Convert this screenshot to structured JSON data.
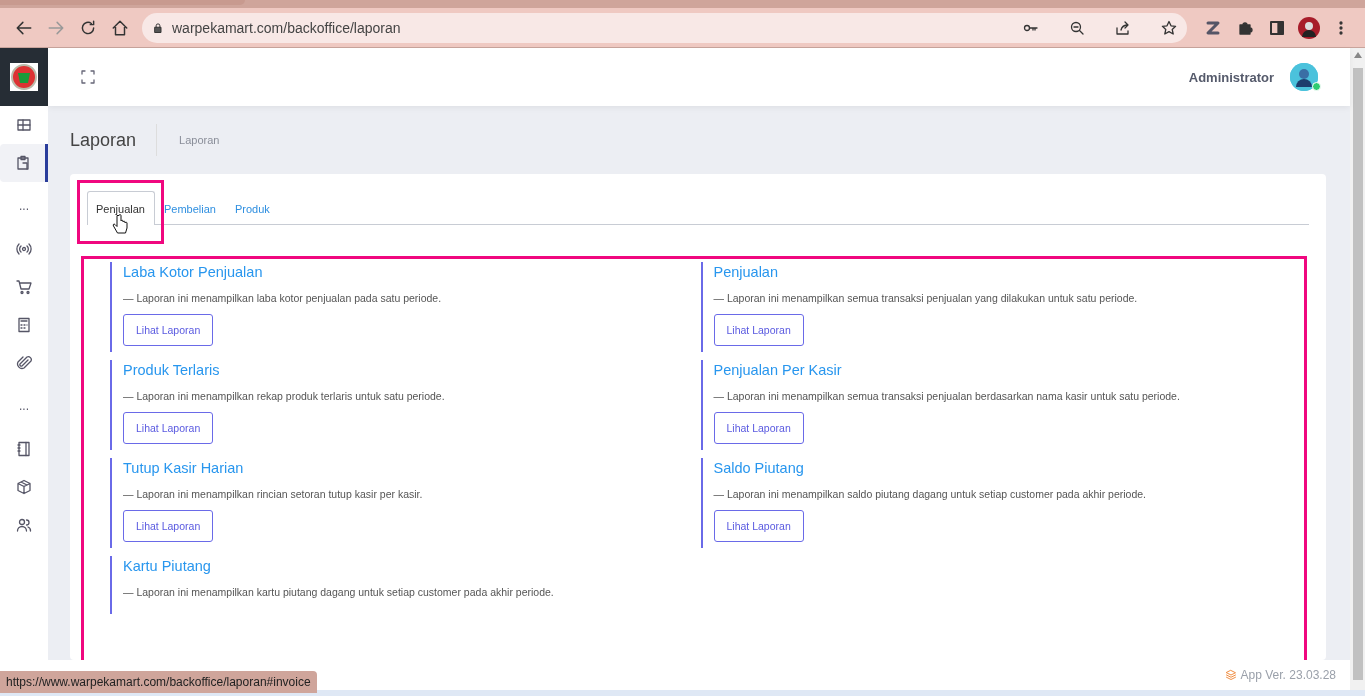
{
  "browser": {
    "url": "warpekamart.com/backoffice/laporan",
    "status_url": "https://www.warpekamart.com/backoffice/laporan#invoice"
  },
  "sidebar": {
    "items": [
      {
        "kind": "icon",
        "selected": false
      },
      {
        "kind": "icon",
        "selected": true
      },
      {
        "kind": "dots",
        "text": "...",
        "selected": false
      },
      {
        "kind": "icon",
        "selected": false
      },
      {
        "kind": "icon",
        "selected": false
      },
      {
        "kind": "icon",
        "selected": false
      },
      {
        "kind": "icon",
        "selected": false
      },
      {
        "kind": "dots",
        "text": "...",
        "selected": false
      },
      {
        "kind": "icon",
        "selected": false
      },
      {
        "kind": "icon",
        "selected": false
      },
      {
        "kind": "icon",
        "selected": false
      }
    ]
  },
  "header": {
    "user": "Administrator",
    "online": true
  },
  "page": {
    "title": "Laporan",
    "breadcrumb": "Laporan"
  },
  "tabs": [
    {
      "label": "Penjualan",
      "selected": true
    },
    {
      "label": "Pembelian",
      "selected": false
    },
    {
      "label": "Produk",
      "selected": false
    }
  ],
  "reports": [
    {
      "title": "Laba Kotor Penjualan",
      "description": "— Laporan ini menampilkan laba kotor penjualan pada satu periode.",
      "button": "Lihat Laporan"
    },
    {
      "title": "Penjualan",
      "description": "— Laporan ini menampilkan semua transaksi penjualan yang dilakukan untuk satu periode.",
      "button": "Lihat Laporan"
    },
    {
      "title": "Produk Terlaris",
      "description": "— Laporan ini menampilkan rekap produk terlaris untuk satu periode.",
      "button": "Lihat Laporan"
    },
    {
      "title": "Penjualan Per Kasir",
      "description": "— Laporan ini menampilkan semua transaksi penjualan berdasarkan nama kasir untuk satu periode.",
      "button": "Lihat Laporan"
    },
    {
      "title": "Tutup Kasir Harian",
      "description": "— Laporan ini menampilkan rincian setoran tutup kasir per kasir.",
      "button": "Lihat Laporan"
    },
    {
      "title": "Saldo Piutang",
      "description": "— Laporan ini menampilkan saldo piutang dagang untuk setiap customer pada akhir periode.",
      "button": "Lihat Laporan"
    },
    {
      "title": "Kartu Piutang",
      "description": "— Laporan ini menampilkan kartu piutang dagang untuk setiap customer pada akhir periode."
    }
  ],
  "footer": {
    "version": "App Ver. 23.03.28"
  }
}
